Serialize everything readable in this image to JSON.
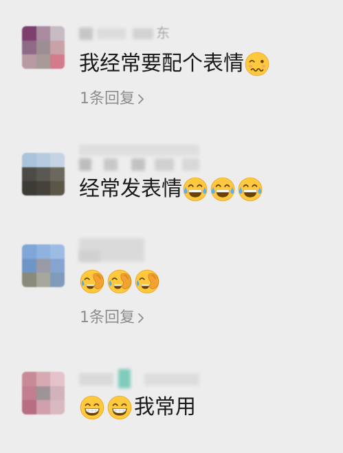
{
  "colors": {
    "background": "#ededed",
    "text": "#1a1a1a",
    "secondary_text": "#8c8c8c",
    "emoji_yellow": "#ffc93f"
  },
  "comments": [
    {
      "username_fragment": "东",
      "avatar_colors": [
        "#7d3f6e",
        "#a88b9e",
        "#c8bcc4",
        "#8e6a86",
        "#9c8e92",
        "#c9a2a8",
        "#b89aa2",
        "#a89a98",
        "#d37b8a"
      ],
      "body": [
        {
          "type": "text",
          "value": "我经常要配个表情"
        },
        {
          "type": "emoji",
          "name": "woozy-face"
        }
      ],
      "reply_label": "1条回复",
      "reply_icon": "chevron-right-icon"
    },
    {
      "avatar_colors": [
        "#a9c3da",
        "#b7cbe0",
        "#c4d4e4",
        "#4c4b48",
        "#5a5852",
        "#6c685e",
        "#3d3b36",
        "#45413a",
        "#5a5648"
      ],
      "body": [
        {
          "type": "text",
          "value": "经常发表情"
        },
        {
          "type": "emoji",
          "name": "face-with-tears-of-joy"
        },
        {
          "type": "emoji",
          "name": "face-with-tears-of-joy"
        },
        {
          "type": "emoji",
          "name": "face-with-tears-of-joy"
        }
      ]
    },
    {
      "avatar_colors": [
        "#7ea6d6",
        "#8fb2de",
        "#9cbce4",
        "#6f95c7",
        "#9a9aa6",
        "#86a4cf",
        "#8a8a7a",
        "#a6a69c",
        "#7f9aba"
      ],
      "body": [
        {
          "type": "emoji",
          "name": "facepalm"
        },
        {
          "type": "emoji",
          "name": "facepalm"
        },
        {
          "type": "emoji",
          "name": "facepalm"
        }
      ],
      "reply_label": "1条回复",
      "reply_icon": "chevron-right-icon"
    },
    {
      "avatar_colors": [
        "#c98a98",
        "#d7a9b3",
        "#e3c3c9",
        "#c27f90",
        "#9e9498",
        "#d2b2bb",
        "#b86d80",
        "#cfa0ac",
        "#d9b8c0"
      ],
      "body": [
        {
          "type": "emoji",
          "name": "grinning-face"
        },
        {
          "type": "emoji",
          "name": "grinning-face"
        },
        {
          "type": "text",
          "value": "我常用"
        }
      ]
    }
  ]
}
